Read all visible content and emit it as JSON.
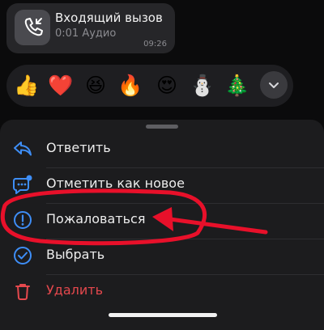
{
  "call": {
    "title": "Входящий вызов",
    "subtitle": "0:01 Аудио",
    "time": "09:26",
    "icon": "incoming-call-icon"
  },
  "reactions": {
    "items": [
      {
        "emoji": "👍",
        "name": "thumbs-up"
      },
      {
        "emoji": "❤️",
        "name": "heart"
      },
      {
        "emoji": "😆",
        "name": "laughing"
      },
      {
        "emoji": "🔥",
        "name": "fire"
      },
      {
        "emoji": "😍",
        "name": "heart-eyes"
      },
      {
        "emoji": "⛄",
        "name": "snowman"
      },
      {
        "emoji": "🎄",
        "name": "christmas-tree"
      }
    ],
    "more_icon": "chevron-down-icon"
  },
  "menu": {
    "items": [
      {
        "label": "Ответить",
        "icon": "reply-icon"
      },
      {
        "label": "Отметить как новое",
        "icon": "mark-unread-icon"
      },
      {
        "label": "Пожаловаться",
        "icon": "report-icon"
      },
      {
        "label": "Выбрать",
        "icon": "select-check-icon"
      },
      {
        "label": "Удалить",
        "icon": "trash-icon"
      }
    ]
  },
  "colors": {
    "accent": "#3e8ef7",
    "danger": "#e5484d",
    "annotation": "#e8102a",
    "sheet": "#1c1c1e"
  }
}
